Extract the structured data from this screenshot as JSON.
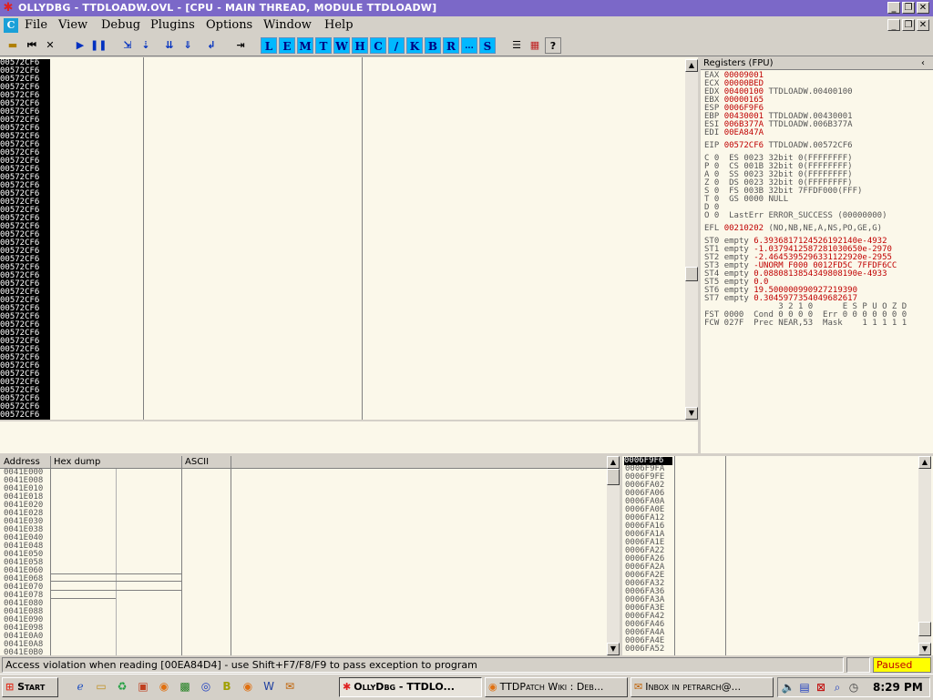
{
  "window": {
    "title": "OllyDbg - TTDLOADW.OVL - [CPU - main thread, module TTDLOADW]"
  },
  "menu": [
    "File",
    "View",
    "Debug",
    "Plugins",
    "Options",
    "Window",
    "Help"
  ],
  "toolbar_letters": [
    "L",
    "E",
    "M",
    "T",
    "W",
    "H",
    "C",
    "/",
    "K",
    "B",
    "R",
    "...",
    "S"
  ],
  "disasm": {
    "address": "00572CF6",
    "row_count": 44
  },
  "registers": {
    "title": "Registers (FPU)",
    "gp": [
      {
        "name": "EAX",
        "value": "00009001",
        "note": ""
      },
      {
        "name": "ECX",
        "value": "00000BED",
        "note": ""
      },
      {
        "name": "EDX",
        "value": "00400100",
        "note": "TTDLOADW.00400100"
      },
      {
        "name": "EBX",
        "value": "00000165",
        "note": ""
      },
      {
        "name": "ESP",
        "value": "0006F9F6",
        "note": ""
      },
      {
        "name": "EBP",
        "value": "00430001",
        "note": "TTDLOADW.00430001"
      },
      {
        "name": "ESI",
        "value": "006B377A",
        "note": "TTDLOADW.006B377A"
      },
      {
        "name": "EDI",
        "value": "00EA847A",
        "note": ""
      }
    ],
    "eip": {
      "name": "EIP",
      "value": "00572CF6",
      "note": "TTDLOADW.00572CF6"
    },
    "flags": [
      {
        "f": "C",
        "v": "0",
        "seg": "ES 0023 32bit 0(FFFFFFFF)"
      },
      {
        "f": "P",
        "v": "0",
        "seg": "CS 001B 32bit 0(FFFFFFFF)"
      },
      {
        "f": "A",
        "v": "0",
        "seg": "SS 0023 32bit 0(FFFFFFFF)"
      },
      {
        "f": "Z",
        "v": "0",
        "seg": "DS 0023 32bit 0(FFFFFFFF)"
      },
      {
        "f": "S",
        "v": "0",
        "seg": "FS 003B 32bit 7FFDF000(FFF)"
      },
      {
        "f": "T",
        "v": "0",
        "seg": "GS 0000 NULL"
      },
      {
        "f": "D",
        "v": "0",
        "seg": ""
      },
      {
        "f": "O",
        "v": "0",
        "seg": "LastErr ERROR_SUCCESS (00000000)"
      }
    ],
    "efl": {
      "name": "EFL",
      "value": "00210202",
      "note": "(NO,NB,NE,A,NS,PO,GE,G)"
    },
    "fpu": [
      {
        "name": "ST0",
        "state": "empty",
        "value": "6.3936817124526192140e-4932"
      },
      {
        "name": "ST1",
        "state": "empty",
        "value": "-1.0379412587281030650e-2970"
      },
      {
        "name": "ST2",
        "state": "empty",
        "value": "-2.4645395296331122920e-2955"
      },
      {
        "name": "ST3",
        "state": "empty",
        "value": "-UNORM F000 0012FD5C 7FFDF6CC"
      },
      {
        "name": "ST4",
        "state": "empty",
        "value": "0.0880813854349808190e-4933"
      },
      {
        "name": "ST5",
        "state": "empty",
        "value": "0.0"
      },
      {
        "name": "ST6",
        "state": "empty",
        "value": "19.500000990927219390"
      },
      {
        "name": "ST7",
        "state": "empty",
        "value": "0.3045977354049682617"
      }
    ],
    "fst_hdr": "               3 2 1 0      E S P U O Z D",
    "fst": "FST 0000  Cond 0 0 0 0  Err 0 0 0 0 0 0 0",
    "fcw": "FCW 027F  Prec NEAR,53  Mask    1 1 1 1 1"
  },
  "dump": {
    "headers": [
      "Address",
      "Hex dump",
      "ASCII"
    ],
    "addresses": [
      "0041E000",
      "0041E008",
      "0041E010",
      "0041E018",
      "0041E020",
      "0041E028",
      "0041E030",
      "0041E038",
      "0041E040",
      "0041E048",
      "0041E050",
      "0041E058",
      "0041E060",
      "0041E068",
      "0041E070",
      "0041E078",
      "0041E080",
      "0041E088",
      "0041E090",
      "0041E098",
      "0041E0A0",
      "0041E0A8",
      "0041E0B0"
    ]
  },
  "stack": {
    "top": "0006F9F6",
    "addresses": [
      "0006F9FA",
      "0006F9FE",
      "0006FA02",
      "0006FA06",
      "0006FA0A",
      "0006FA0E",
      "0006FA12",
      "0006FA16",
      "0006FA1A",
      "0006FA1E",
      "0006FA22",
      "0006FA26",
      "0006FA2A",
      "0006FA2E",
      "0006FA32",
      "0006FA36",
      "0006FA3A",
      "0006FA3E",
      "0006FA42",
      "0006FA46",
      "0006FA4A",
      "0006FA4E",
      "0006FA52"
    ]
  },
  "status": {
    "message": "Access violation when reading [00EA84D4] - use Shift+F7/F8/F9 to pass exception to program",
    "state": "Paused",
    "state_color": "#ffff00"
  },
  "taskbar": {
    "start": "Start",
    "tasks": [
      "OllyDbg - TTDLO...",
      "TTDPatch Wiki : Deb...",
      "Inbox in petrarch@..."
    ],
    "clock": "8:29 PM"
  }
}
